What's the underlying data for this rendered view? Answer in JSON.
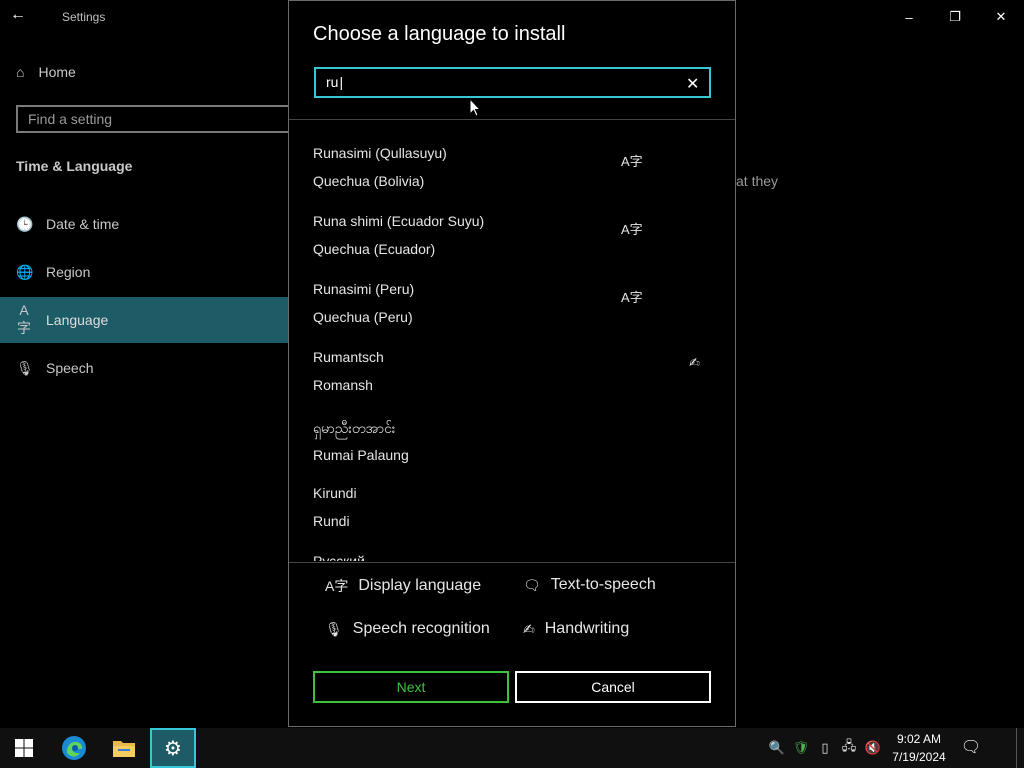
{
  "window": {
    "back_glyph": "←",
    "title": "Settings",
    "controls": {
      "minimize": "–",
      "maximize": "❐",
      "close": "✕"
    }
  },
  "sidebar": {
    "home": "Home",
    "home_icon": "home-icon",
    "search_placeholder": "Find a setting",
    "section_title": "Time & Language",
    "items": [
      {
        "label": "Date & time",
        "icon": "calendar-clock-icon",
        "glyph": "🕒"
      },
      {
        "label": "Region",
        "icon": "globe-icon",
        "glyph": "🌐"
      },
      {
        "label": "Language",
        "icon": "language-icon",
        "glyph": "A字",
        "selected": true
      },
      {
        "label": "Speech",
        "icon": "microphone-icon",
        "glyph": "🎙"
      }
    ]
  },
  "background_text": "at they",
  "dialog": {
    "title": "Choose a language to install",
    "search_value": "ru",
    "clear_glyph": "✕",
    "languages": [
      {
        "name": "Runasimi (Qullasuyu)",
        "sub": "Quechua (Bolivia)",
        "icons": [
          "A字"
        ]
      },
      {
        "name": "Runa shimi (Ecuador Suyu)",
        "sub": "Quechua (Ecuador)",
        "icons": [
          "A字"
        ]
      },
      {
        "name": "Runasimi (Peru)",
        "sub": "Quechua (Peru)",
        "icons": [
          "A字"
        ]
      },
      {
        "name": "Rumantsch",
        "sub": "Romansh",
        "icons": [
          "✍"
        ]
      },
      {
        "name": "ရှမာညီးတအာင်း",
        "sub": "Rumai Palaung",
        "icons": []
      },
      {
        "name": "Kirundi",
        "sub": "Rundi",
        "icons": []
      },
      {
        "name": "Русский",
        "sub": "",
        "icons": [
          "A字",
          "🗨",
          "✍"
        ]
      }
    ],
    "legend": {
      "display_language": "Display language",
      "text_to_speech": "Text-to-speech",
      "speech_recognition": "Speech recognition",
      "handwriting": "Handwriting",
      "glyphs": {
        "display": "A字",
        "tts": "🗨",
        "speech": "🎙",
        "handwriting": "✍"
      }
    },
    "next_label": "Next",
    "cancel_label": "Cancel"
  },
  "taskbar": {
    "time": "9:02 AM",
    "date": "7/19/2024",
    "colors": {
      "accent": "#38c7d8",
      "next_green": "#3cc33c",
      "selected_nav": "#1d5b66"
    }
  }
}
